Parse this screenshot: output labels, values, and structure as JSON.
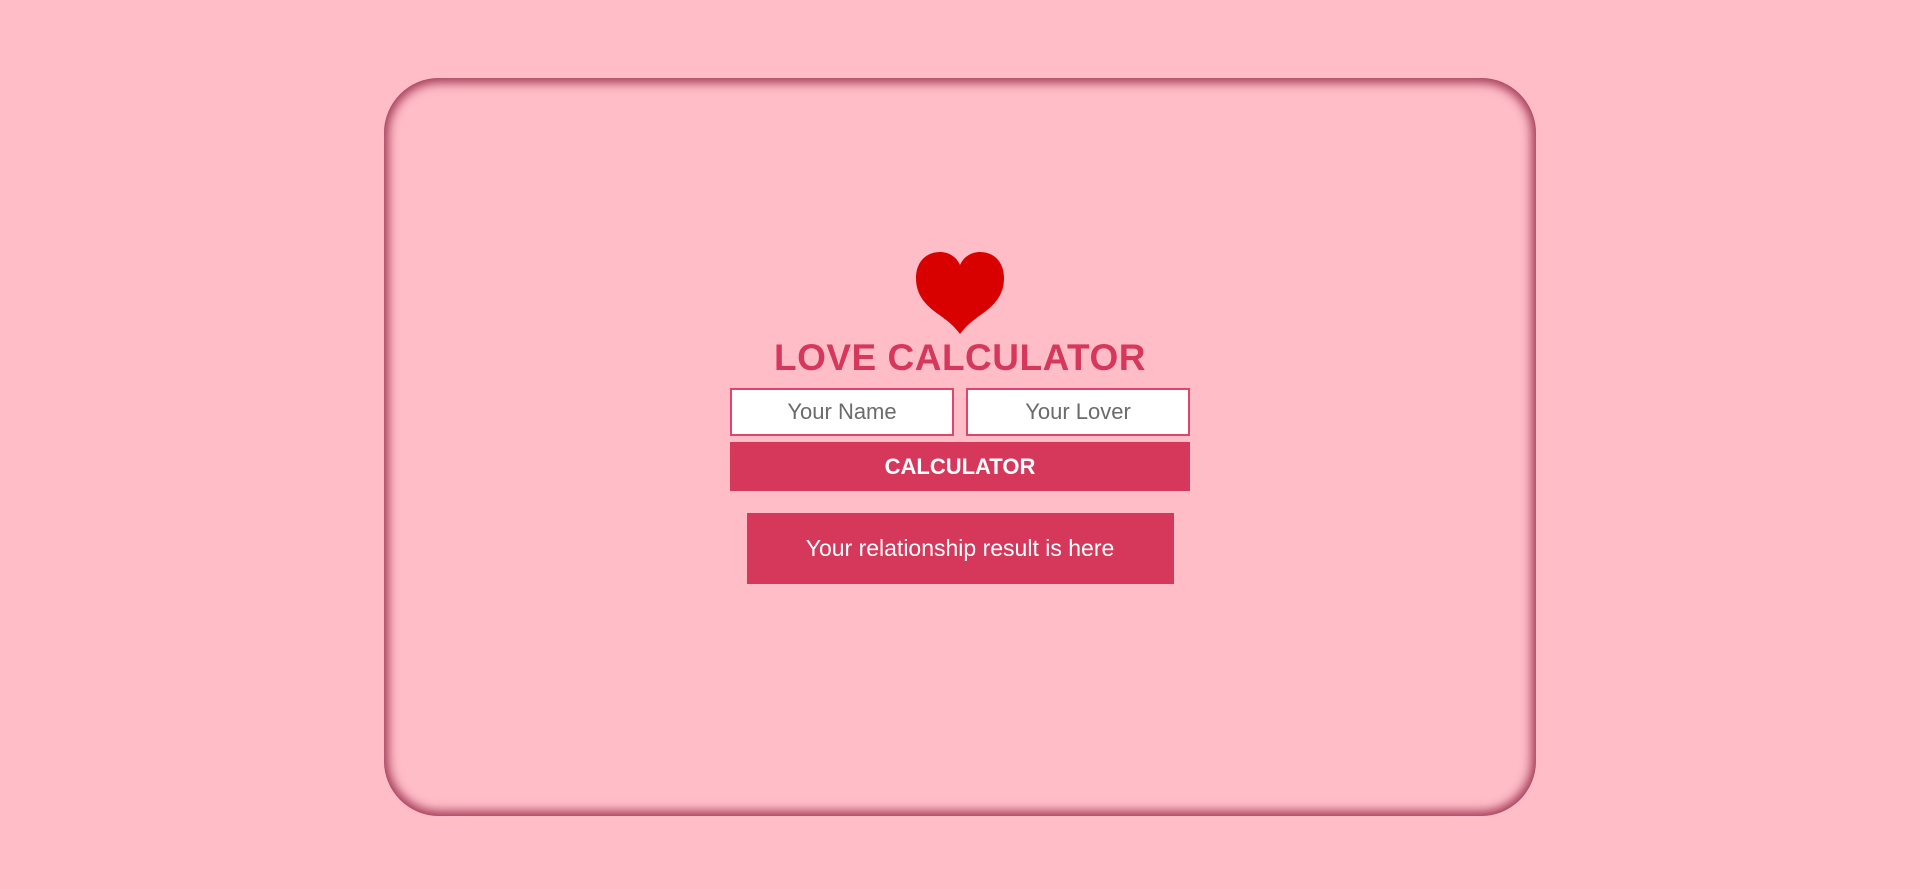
{
  "app": {
    "title": "LOVE CALCULATOR",
    "icon": "heart-icon"
  },
  "form": {
    "name_placeholder": "Your Name",
    "name_value": "",
    "lover_placeholder": "Your Lover",
    "lover_value": "",
    "button_label": "CALCULATOR"
  },
  "result": {
    "text": "Your relationship result is here"
  },
  "colors": {
    "background": "#ffbdc8",
    "accent": "#d6385c",
    "heart": "#d90000",
    "input_border": "#e0446a"
  }
}
